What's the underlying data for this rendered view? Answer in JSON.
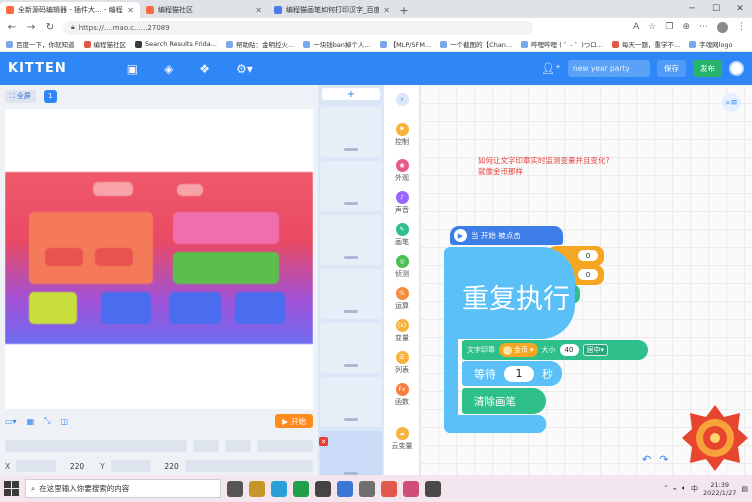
{
  "browser": {
    "tabs": [
      {
        "label": "全新源码编辑器 - 插件大... - 编程猫",
        "active": true
      },
      {
        "label": "编程猫社区",
        "active": false
      },
      {
        "label": "编程猫画笔如何打印汉字_百度搜索",
        "active": false
      }
    ],
    "new_tab": "+",
    "url": "https://....mao.c......27089",
    "bookmarks": [
      "百度一下，你就知道",
      "编程猫社区",
      "Search Results Frida...",
      "帮助贴：金明控火...",
      "一块钱ban掉个人...",
      "【MLP/SFM...",
      "一个截图的【Chan...",
      "哔哩哔哩 ( ゜- ゜)つロ...",
      "每天一题，重学不...",
      "字魂网logo"
    ]
  },
  "app_header": {
    "logo": "KITTEN",
    "project_name_placeholder": "new year party",
    "save_label": "保存",
    "publish_label": "发布"
  },
  "stage": {
    "fullscreen_label": "全屏",
    "scene_count": "1",
    "start_label": "开始",
    "x_label": "X",
    "x_value": "220",
    "y_label": "Y",
    "y_value": "220"
  },
  "sprite_list": {
    "add_label": "+"
  },
  "categories": [
    {
      "label": "控制",
      "color": "#f7b23b",
      "icon": "control-icon"
    },
    {
      "label": "外观",
      "color": "#e85a8c",
      "icon": "looks-icon"
    },
    {
      "label": "声音",
      "color": "#9966ff",
      "icon": "sound-icon"
    },
    {
      "label": "画笔",
      "color": "#2fbf8a",
      "icon": "pen-icon"
    },
    {
      "label": "侦测",
      "color": "#4cbf56",
      "icon": "sensing-icon"
    },
    {
      "label": "运算",
      "color": "#f78a3b",
      "icon": "operators-icon"
    },
    {
      "label": "变量",
      "color": "#f7b23b",
      "icon": "variables-icon"
    },
    {
      "label": "列表",
      "color": "#f7b23b",
      "icon": "list-icon"
    },
    {
      "label": "函数",
      "color": "#f77b3b",
      "icon": "function-icon"
    },
    {
      "label": "云变量",
      "color": "#f7b23b",
      "icon": "cloud-variable-icon"
    }
  ],
  "workspace": {
    "question_line1": "如何让文字印章实时监测变量并且变化?",
    "question_line2": "就像金币那样",
    "when_start_clicked": "当 开始 被点击",
    "oval_value_1": "0",
    "oval_value_2": "0",
    "repeat_label": "重复执行",
    "stamp_text_label": "文字印章",
    "coin_variable": "金币",
    "size_label": "大小",
    "size_value": "40",
    "align_value": "居中",
    "wait_label": "等待",
    "wait_value": "1",
    "seconds_label": "秒",
    "clear_pen_label": "清除画笔"
  },
  "taskbar": {
    "search_placeholder": "在这里输入你要搜索的内容",
    "time": "21:39",
    "date": "2022/1/27",
    "input_method": "中"
  }
}
